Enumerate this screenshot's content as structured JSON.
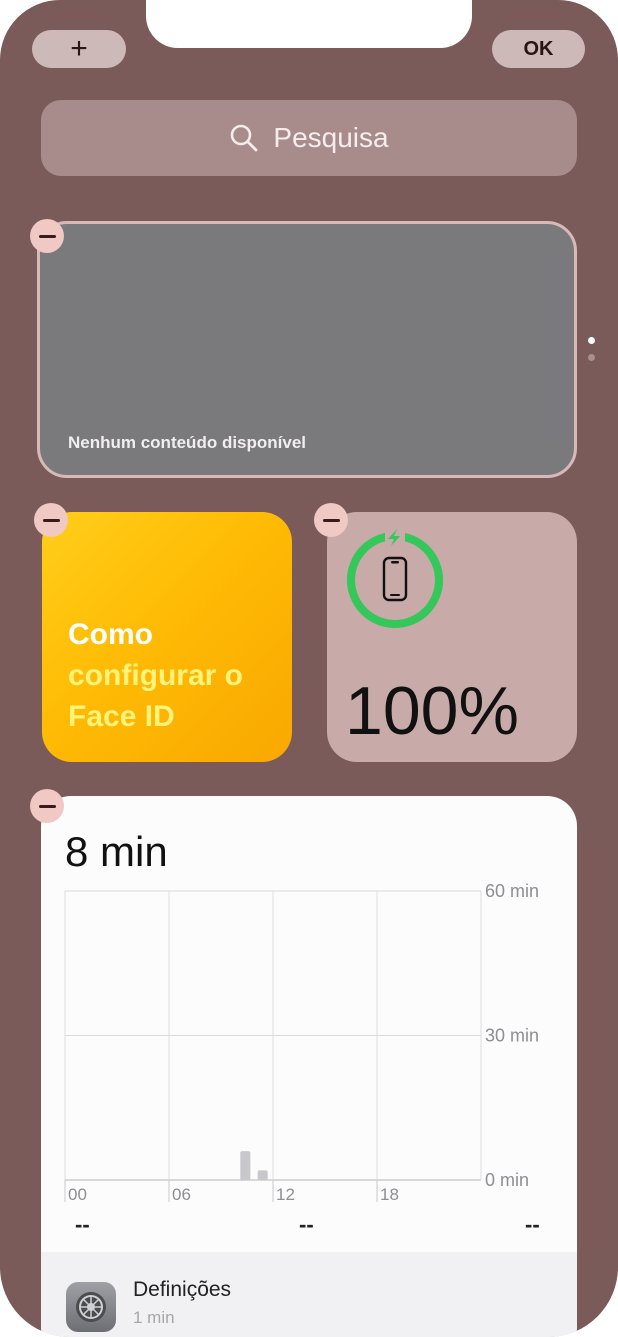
{
  "toolbar": {
    "add_label": "+",
    "done_label": "OK"
  },
  "search": {
    "icon": "search-icon",
    "placeholder": "Pesquisa"
  },
  "widgets": {
    "empty": {
      "message": "Nenhum conteúdo disponível",
      "pages": 2,
      "current_page": 1
    },
    "tip": {
      "line1": "Como",
      "line2": "configurar o",
      "line3": "Face ID",
      "accent_color": "#fff37a"
    },
    "battery": {
      "device_icon": "iphone-icon",
      "charging_icon": "lightning-bolt-icon",
      "level": 1.0,
      "percent_label": "100%",
      "ring_color": "#34c759"
    },
    "screen_time": {
      "total": "8 min",
      "app": {
        "name": "Definições",
        "time": "1 min",
        "icon": "settings-gear-icon"
      },
      "dashes": [
        "--",
        "--",
        "--"
      ]
    }
  },
  "chart_data": {
    "type": "bar",
    "xlabels": [
      "00",
      "06",
      "12",
      "18"
    ],
    "ylabels": [
      "60 min",
      "30 min",
      "0 min"
    ],
    "ylim": [
      0,
      60
    ],
    "hours": [
      10,
      11
    ],
    "values": [
      6,
      2
    ],
    "bar_color": "#c7c7cc",
    "grid": true
  }
}
